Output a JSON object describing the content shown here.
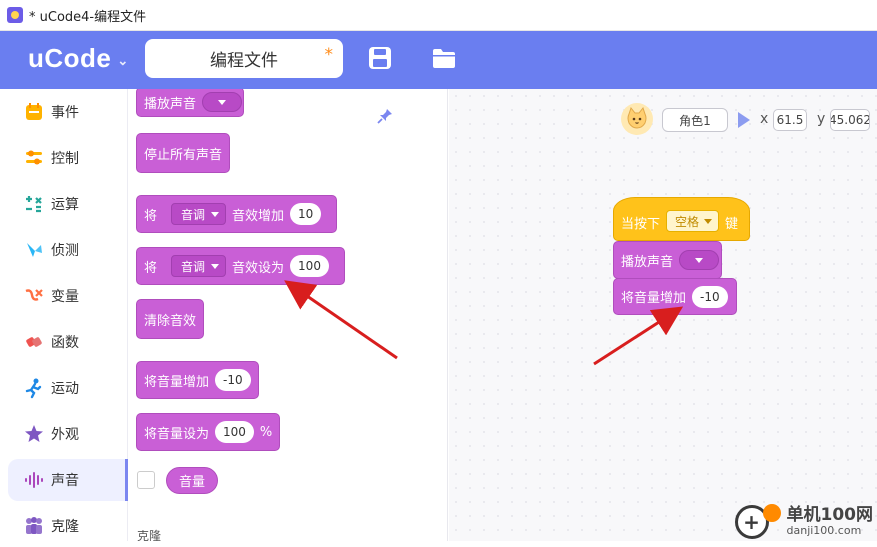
{
  "window": {
    "title": "* uCode4-编程文件"
  },
  "header": {
    "logo": "uCode",
    "file_name": "编程文件",
    "unsaved_mark": "*",
    "accent": "#6a7ef0"
  },
  "categories": [
    {
      "label": "事件",
      "icon": "event-icon"
    },
    {
      "label": "控制",
      "icon": "control-icon"
    },
    {
      "label": "运算",
      "icon": "operator-icon"
    },
    {
      "label": "侦测",
      "icon": "sensing-icon"
    },
    {
      "label": "变量",
      "icon": "variable-icon"
    },
    {
      "label": "函数",
      "icon": "function-icon"
    },
    {
      "label": "运动",
      "icon": "motion-icon"
    },
    {
      "label": "外观",
      "icon": "looks-icon"
    },
    {
      "label": "声音",
      "icon": "sound-icon",
      "active": true
    },
    {
      "label": "克隆",
      "icon": "clone-icon"
    }
  ],
  "palette": {
    "play_sound": "播放声音",
    "stop_all_sounds": "停止所有声音",
    "change_effect": {
      "prefix": "将",
      "dropdown": "音调",
      "suffix": "音效增加",
      "value": "10"
    },
    "set_effect": {
      "prefix": "将",
      "dropdown": "音调",
      "suffix": "音效设为",
      "value": "100"
    },
    "clear_effects": "清除音效",
    "change_volume": {
      "label": "将音量增加",
      "value": "-10"
    },
    "set_volume": {
      "label": "将音量设为",
      "value": "100",
      "unit": "%"
    },
    "volume_reporter": "音量",
    "next_section": "克隆"
  },
  "stage": {
    "sprite_name": "角色1",
    "x_label": "x",
    "x_value": "61.5",
    "y_label": "y",
    "y_value": "45.062",
    "script": {
      "hat": {
        "prefix": "当按下",
        "key": "空格",
        "suffix": "键"
      },
      "play_sound": "播放声音",
      "change_volume": {
        "label": "将音量增加",
        "value": "-10"
      }
    }
  },
  "watermark": {
    "title": "单机100网",
    "url": "danji100.com"
  }
}
